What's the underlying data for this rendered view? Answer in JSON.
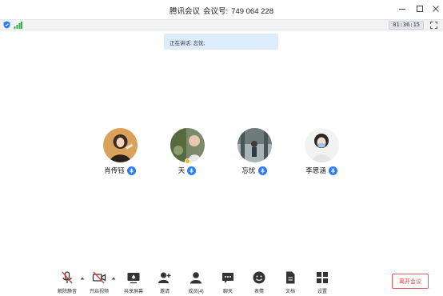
{
  "window": {
    "app_name": "腾讯会议",
    "meeting_label": "会议号:",
    "meeting_id": "749 064 228"
  },
  "status": {
    "timer": "01:36:15"
  },
  "speaking_banner": "正在讲话: 忘忧;",
  "participants": [
    {
      "name": "肖传钰",
      "mic": "mic-icon"
    },
    {
      "name": "天",
      "mic": "mic-icon",
      "host_badge": true
    },
    {
      "name": "忘忧",
      "mic": "mic-icon"
    },
    {
      "name": "李思涵",
      "mic": "mic-icon"
    }
  ],
  "toolbar": {
    "unmute": "解除静音",
    "start_video": "开启视频",
    "share_screen": "共享屏幕",
    "invite": "邀请",
    "members": "成员(4)",
    "chat": "聊天",
    "reactions": "表情",
    "docs": "文档",
    "settings": "设置",
    "leave": "离开会议"
  },
  "colors": {
    "accent": "#2b7cf6",
    "leave": "#e03c3c",
    "banner": "#dcecfb"
  }
}
